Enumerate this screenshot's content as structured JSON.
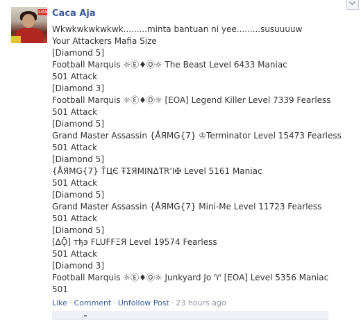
{
  "post": {
    "author": "Caca Aja",
    "avatar_icon": "profile-photo",
    "avatar_tag": "JUAN",
    "menu_icon": "chevron-down-icon",
    "lines": [
      "Wkwkwkwkwkwk.........minta bantuan ni yee.........susuuuuw",
      "Your Attackers Mafia Size",
      "[Diamond 5]",
      "Football Marquis ☼Ⓔ♦Ⓞ☼ The Beast Level 6433 Maniac",
      "501 Attack",
      "[Diamond 3]",
      "Football Marquis ☼Ⓔ♦Ⓞ☼ [EOA] Legend Killer Level 7339 Fearless",
      "501 Attack",
      "[Diamond 5]",
      "Grand Master Assassin {ÅЯMG{7} ♔Terminator Level 15473 Fearless",
      "501 Attack",
      "[Diamond 5]",
      "{ÅЯMG{7} ŤЦЄ ŦƩЯMINΔTR'I✠ Level 5161 Maniac",
      "501 Attack",
      "[Diamond 5]",
      "Grand Master Assassin {ÅЯMG{7} Mini-Me Level 11723 Fearless",
      "501 Attack",
      "[Diamond 5]",
      "[ΔǬ] тђэ FLUFFΞЯ Level 19574 Fearless",
      "501 Attack",
      "[Diamond 3]",
      "Football Marquis ☼Ⓔ♦Ⓞ☼ Junkyard Jo ♈ [EOA] Level 5356 Maniac",
      "501"
    ]
  },
  "actions": {
    "like": "Like",
    "comment": "Comment",
    "unfollow": "Unfollow Post",
    "separator": "·",
    "timestamp": "23 hours ago"
  },
  "colors": {
    "link": "#3b5998",
    "meta": "#9197a3",
    "text": "#333333"
  }
}
